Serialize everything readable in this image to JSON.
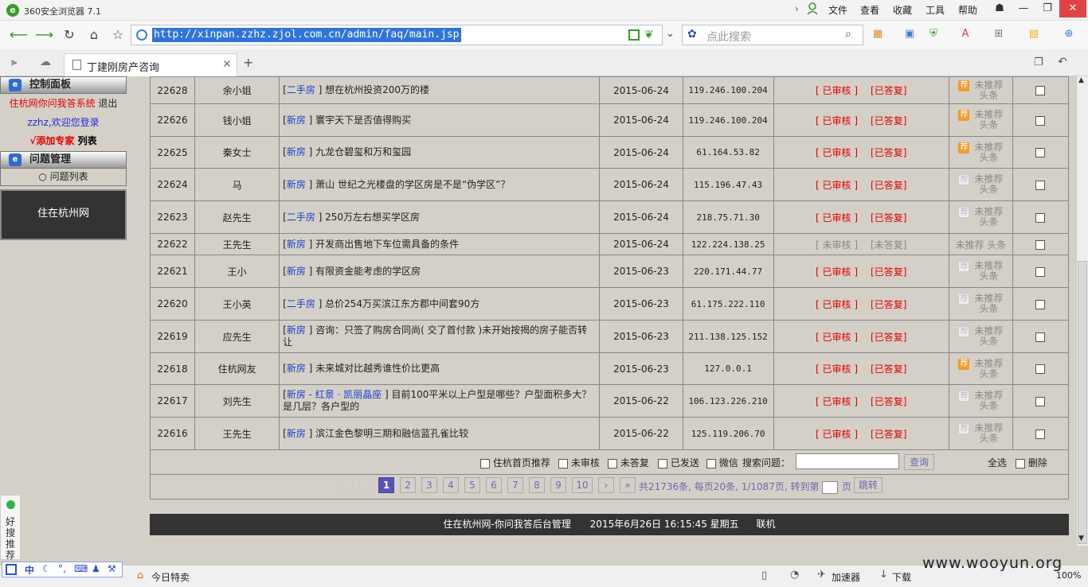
{
  "browser": {
    "title": "360安全浏览器 7.1",
    "menus": [
      "文件",
      "查看",
      "收藏",
      "工具",
      "帮助"
    ],
    "url": "http://xinpan.zzhz.zjol.com.cn/admin/faq/main.jsp",
    "search_placeholder": "点此搜索",
    "tab_label": "丁建刚房产咨询",
    "new_tab": "+"
  },
  "sidebar": {
    "panel_title": "控制面板",
    "system_name": "住杭网你问我答系统",
    "logout": "退出",
    "welcome": "zzhz,欢迎您登录",
    "add_expert": "√添加专家",
    "list": "列表",
    "question_title": "问题管理",
    "question_list": "○ 问题列表",
    "brand_box": "住在杭州网"
  },
  "status_labels": {
    "reviewed": "[ 已审核 ]",
    "answered": "[已答复]",
    "unreviewed": "[ 未审核 ]",
    "unanswered": "[未答复]",
    "tj_line1": "未推荐",
    "tj_line2": "头条",
    "tj_inline": "未推荐 头条",
    "tj_icon": "荐"
  },
  "rows": [
    {
      "id": "22628",
      "name": "余小姐",
      "cat": "二手房",
      "title": "想在杭州投资200万的楼",
      "date": "2015-06-24",
      "ip": "119.246.100.204",
      "reviewed": true,
      "tj": "on"
    },
    {
      "id": "22626",
      "name": "钱小姐",
      "cat": "新房",
      "title": "寰宇天下是否值得购买",
      "date": "2015-06-24",
      "ip": "119.246.100.204",
      "reviewed": true,
      "tj": "on"
    },
    {
      "id": "22625",
      "name": "秦女士",
      "cat": "新房",
      "title": "九龙仓碧玺和万和玺园",
      "date": "2015-06-24",
      "ip": "61.164.53.82",
      "reviewed": true,
      "tj": "on"
    },
    {
      "id": "22624",
      "name": "马",
      "cat": "新房",
      "title": "萧山 世纪之光楼盘的学区房是不是“伪学区”？",
      "date": "2015-06-24",
      "ip": "115.196.47.43",
      "reviewed": true,
      "tj": "off"
    },
    {
      "id": "22623",
      "name": "赵先生",
      "cat": "二手房",
      "title": "250万左右想买学区房",
      "date": "2015-06-24",
      "ip": "218.75.71.30",
      "reviewed": true,
      "tj": "off"
    },
    {
      "id": "22622",
      "name": "王先生",
      "cat": "新房",
      "title": "开发商出售地下车位需具备的条件",
      "date": "2015-06-24",
      "ip": "122.224.138.25",
      "reviewed": false,
      "tj": "none"
    },
    {
      "id": "22621",
      "name": "王小",
      "cat": "新房",
      "title": "有限资金能考虑的学区房",
      "date": "2015-06-23",
      "ip": "220.171.44.77",
      "reviewed": true,
      "tj": "off"
    },
    {
      "id": "22620",
      "name": "王小英",
      "cat": "二手房",
      "title": "总价254万买滨江东方郡中间套90方",
      "date": "2015-06-23",
      "ip": "61.175.222.110",
      "reviewed": true,
      "tj": "off"
    },
    {
      "id": "22619",
      "name": "应先生",
      "cat": "新房",
      "title": "咨询：只签了购房合同尚( 交了首付款 )未开始按揭的房子能否转让",
      "date": "2015-06-23",
      "ip": "211.138.125.152",
      "reviewed": true,
      "tj": "off"
    },
    {
      "id": "22618",
      "name": "住杭网友",
      "cat": "新房",
      "title": "未来城对比越秀谁性价比更高",
      "date": "2015-06-23",
      "ip": "127.0.0.1",
      "reviewed": true,
      "tj": "on"
    },
    {
      "id": "22617",
      "name": "刘先生",
      "cat": "新房 - 红景 · 凯丽晶座",
      "title": "目前100平米以上户型是哪些？户型面积多大？是几层？各户型的",
      "date": "2015-06-22",
      "ip": "106.123.226.210",
      "reviewed": true,
      "tj": "off"
    },
    {
      "id": "22616",
      "name": "王先生",
      "cat": "新房",
      "title": "滨江金色黎明三期和融信蓝孔雀比较",
      "date": "2015-06-22",
      "ip": "125.119.206.70",
      "reviewed": true,
      "tj": "off"
    }
  ],
  "filters": {
    "home_recommend": "住杭首页推荐",
    "unreviewed": "未审核",
    "unanswered": "未答复",
    "sent": "已发送",
    "wechat": "微信",
    "search_label": "搜索问题：",
    "search_value": "",
    "search_button": "查询",
    "select_all": "全选",
    "delete": "删除"
  },
  "pager": {
    "pages": [
      "1",
      "2",
      "3",
      "4",
      "5",
      "6",
      "7",
      "8",
      "9",
      "10"
    ],
    "current": "1",
    "next": "›",
    "last": "»",
    "summary": "共21736条, 每页20条, 1/1087页, 转到第",
    "page_unit": "页",
    "jump": "跳转"
  },
  "footer": {
    "site": "住在杭州网-你问我答后台管理",
    "datetime": "2015年6月26日 16:15:45 星期五",
    "status": "联机"
  },
  "statusbar": {
    "today": "今日特卖",
    "accelerator": "加速器",
    "download": "下载",
    "zoom": "100%",
    "side_push": "好搜推荐",
    "ime": "中"
  },
  "watermark": "www.wooyun.org"
}
